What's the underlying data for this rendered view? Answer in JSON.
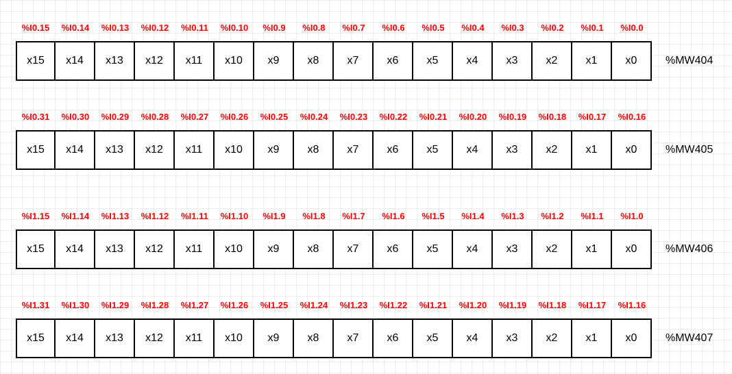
{
  "rows": [
    {
      "word": "%MW404",
      "labels": [
        "%I0.15",
        "%I0.14",
        "%I0.13",
        "%I0.12",
        "%I0.11",
        "%I0.10",
        "%I0.9",
        "%I0.8",
        "%I0.7",
        "%I0.6",
        "%I0.5",
        "%I0.4",
        "%I0.3",
        "%I0.2",
        "%I0.1",
        "%I0.0"
      ],
      "cells": [
        "x15",
        "x14",
        "x13",
        "x12",
        "x11",
        "x10",
        "x9",
        "x8",
        "x7",
        "x6",
        "x5",
        "x4",
        "x3",
        "x2",
        "x1",
        "x0"
      ]
    },
    {
      "word": "%MW405",
      "labels": [
        "%I0.31",
        "%I0.30",
        "%I0.29",
        "%I0.28",
        "%I0.27",
        "%I0.26",
        "%I0.25",
        "%I0.24",
        "%I0.23",
        "%I0.22",
        "%I0.21",
        "%I0.20",
        "%I0.19",
        "%I0.18",
        "%I0.17",
        "%I0.16"
      ],
      "cells": [
        "x15",
        "x14",
        "x13",
        "x12",
        "x11",
        "x10",
        "x9",
        "x8",
        "x7",
        "x6",
        "x5",
        "x4",
        "x3",
        "x2",
        "x1",
        "x0"
      ]
    },
    {
      "word": "%MW406",
      "labels": [
        "%I1.15",
        "%I1.14",
        "%I1.13",
        "%I1.12",
        "%I1.11",
        "%I1.10",
        "%I1.9",
        "%I1.8",
        "%I1.7",
        "%I1.6",
        "%I1.5",
        "%I1.4",
        "%I1.3",
        "%I1.2",
        "%I1.1",
        "%I1.0"
      ],
      "cells": [
        "x15",
        "x14",
        "x13",
        "x12",
        "x11",
        "x10",
        "x9",
        "x8",
        "x7",
        "x6",
        "x5",
        "x4",
        "x3",
        "x2",
        "x1",
        "x0"
      ]
    },
    {
      "word": "%MW407",
      "labels": [
        "%I1.31",
        "%I1.30",
        "%I1.29",
        "%I1.28",
        "%I1.27",
        "%I1.26",
        "%I1.25",
        "%I1.24",
        "%I1.23",
        "%I1.22",
        "%I1.21",
        "%I1.20",
        "%I1.19",
        "%I1.18",
        "%I1.17",
        "%I1.16"
      ],
      "cells": [
        "x15",
        "x14",
        "x13",
        "x12",
        "x11",
        "x10",
        "x9",
        "x8",
        "x7",
        "x6",
        "x5",
        "x4",
        "x3",
        "x2",
        "x1",
        "x0"
      ]
    }
  ],
  "colors": {
    "label_color": "#ff0000",
    "cell_border": "#000000",
    "grid": "#ececec",
    "background": "#ffffff"
  }
}
